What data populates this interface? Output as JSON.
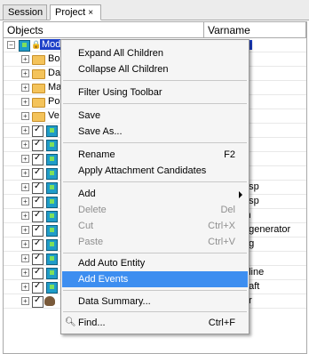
{
  "tabs": [
    {
      "label": "Session"
    },
    {
      "label": "Project",
      "close": "×"
    }
  ],
  "columns": {
    "objects": "Objects",
    "varname": "Varname"
  },
  "tree": {
    "root_label": "Model",
    "folders": [
      "Bo",
      "Da",
      "Ma",
      "Po",
      "Ve"
    ],
    "entity_varnames": [
      "",
      "",
      "",
      "",
      "usp",
      "usp",
      "in",
      "_generator",
      "ng",
      "s",
      "eline",
      "haft",
      "er"
    ]
  },
  "menu": {
    "items": [
      {
        "label": "Expand All Children",
        "shortcut": ""
      },
      {
        "label": "Collapse All Children",
        "shortcut": ""
      },
      {
        "label": "Filter Using Toolbar",
        "shortcut": ""
      },
      {
        "label": "Save",
        "shortcut": ""
      },
      {
        "label": "Save As...",
        "shortcut": ""
      },
      {
        "label": "Rename",
        "shortcut": "F2"
      },
      {
        "label": "Apply Attachment Candidates",
        "shortcut": ""
      },
      {
        "label": "Add",
        "shortcut": ""
      },
      {
        "label": "Delete",
        "shortcut": "Del"
      },
      {
        "label": "Cut",
        "shortcut": "Ctrl+X"
      },
      {
        "label": "Paste",
        "shortcut": "Ctrl+V"
      },
      {
        "label": "Add Auto Entity",
        "shortcut": ""
      },
      {
        "label": "Add Events",
        "shortcut": ""
      },
      {
        "label": "Data Summary...",
        "shortcut": ""
      },
      {
        "label": "Find...",
        "shortcut": "Ctrl+F"
      }
    ]
  }
}
